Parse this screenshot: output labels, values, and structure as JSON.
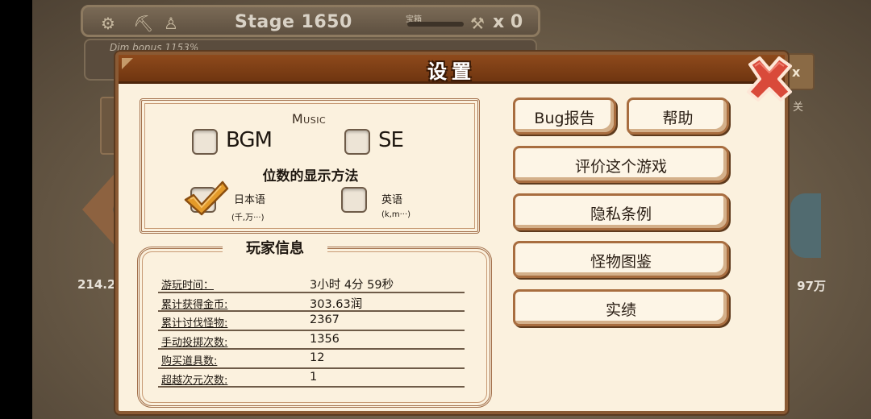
{
  "background": {
    "stage_text": "Stage 1650",
    "treasure_label": "宝箱",
    "multiplier_text": "x 0",
    "dim_bonus_text": "Dim bonus  1153%",
    "left_value": "214.2",
    "right_value": "97万",
    "right_button_text": "x",
    "right_sub_text": "关"
  },
  "dialog": {
    "title": "设置",
    "music_label": "Music",
    "bgm_label": "BGM",
    "se_label": "SE",
    "bgm_checked": false,
    "se_checked": false,
    "digit_display_title": "位数的显示方法",
    "option_japanese": "日本语",
    "option_japanese_sub": "(千,万···)",
    "option_english": "英语",
    "option_english_sub": "(k,m···)",
    "japanese_selected": true,
    "player_info_title": "玩家信息",
    "player_info": [
      {
        "label": "游玩时间：",
        "value": "3小时 4分 59秒"
      },
      {
        "label": "累计获得金币:",
        "value": "303.63润"
      },
      {
        "label": "累计讨伐怪物:",
        "value": "2367"
      },
      {
        "label": "手动投掷次数:",
        "value": "1356"
      },
      {
        "label": "购买道具数:",
        "value": "12"
      },
      {
        "label": "超越次元次数:",
        "value": "1"
      }
    ],
    "buttons": {
      "bug_report": "Bug报告",
      "help": "帮助",
      "rate_game": "评价这个游戏",
      "privacy": "隐私条例",
      "monster_book": "怪物图鉴",
      "achievements": "实绩"
    },
    "colors": {
      "header": "#8e4a1c",
      "panel": "#fbf1de",
      "close": "#d94a3a",
      "check": "#e39a2a"
    }
  }
}
